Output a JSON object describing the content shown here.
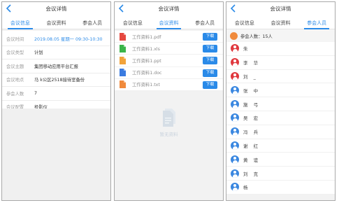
{
  "colors": {
    "accent": "#2a8ae8",
    "pdf": "#e5483f",
    "xls": "#3bb54a",
    "ppt": "#f2a33a",
    "doc": "#3a7be0",
    "txt": "#f08a3c",
    "attendee_red": "#e0383e",
    "attendee_blue": "#3a87e0"
  },
  "header": {
    "title": "会议详情",
    "back_icon": "chevron-left-icon"
  },
  "tabs": [
    "会议信息",
    "会议资料",
    "参会人员"
  ],
  "info_rows": [
    {
      "label": "会议时间",
      "value": "2019.08.05 星期一 09:30-10:30"
    },
    {
      "label": "会议类型",
      "value": "计划"
    },
    {
      "label": "会议主题",
      "value": "集团移动应用平台汇报"
    },
    {
      "label": "会议地点",
      "value": "马   k公区2518接待室备份"
    },
    {
      "label": "参会人数",
      "value": "7"
    },
    {
      "label": "会议配置",
      "value": "投影仪"
    }
  ],
  "files": [
    {
      "name": "工作资料1.pdf",
      "type": "pdf",
      "download_label": "下载"
    },
    {
      "name": "工作资料1.xls",
      "type": "xls",
      "download_label": "下载"
    },
    {
      "name": "工作资料1.ppt",
      "type": "ppt",
      "download_label": "下载"
    },
    {
      "name": "工作资料1.doc",
      "type": "doc",
      "download_label": "下载"
    },
    {
      "name": "工作资料1.txt",
      "type": "txt",
      "download_label": "下载"
    }
  ],
  "empty_state": {
    "text": "暂无资料"
  },
  "attendee_count": "参会人数：15人",
  "attendees": [
    {
      "name": "朱 ",
      "color": "red"
    },
    {
      "name": "李 华",
      "color": "red"
    },
    {
      "name": "刘 _",
      "color": "red"
    },
    {
      "name": "张 中",
      "color": "blue"
    },
    {
      "name": "施 弓",
      "color": "blue"
    },
    {
      "name": "吴 宏",
      "color": "blue"
    },
    {
      "name": "冯 兵",
      "color": "blue"
    },
    {
      "name": "谢 红",
      "color": "blue"
    },
    {
      "name": "黄 谊",
      "color": "blue"
    },
    {
      "name": "刘 克",
      "color": "blue"
    },
    {
      "name": "杨 ",
      "color": "blue"
    }
  ]
}
